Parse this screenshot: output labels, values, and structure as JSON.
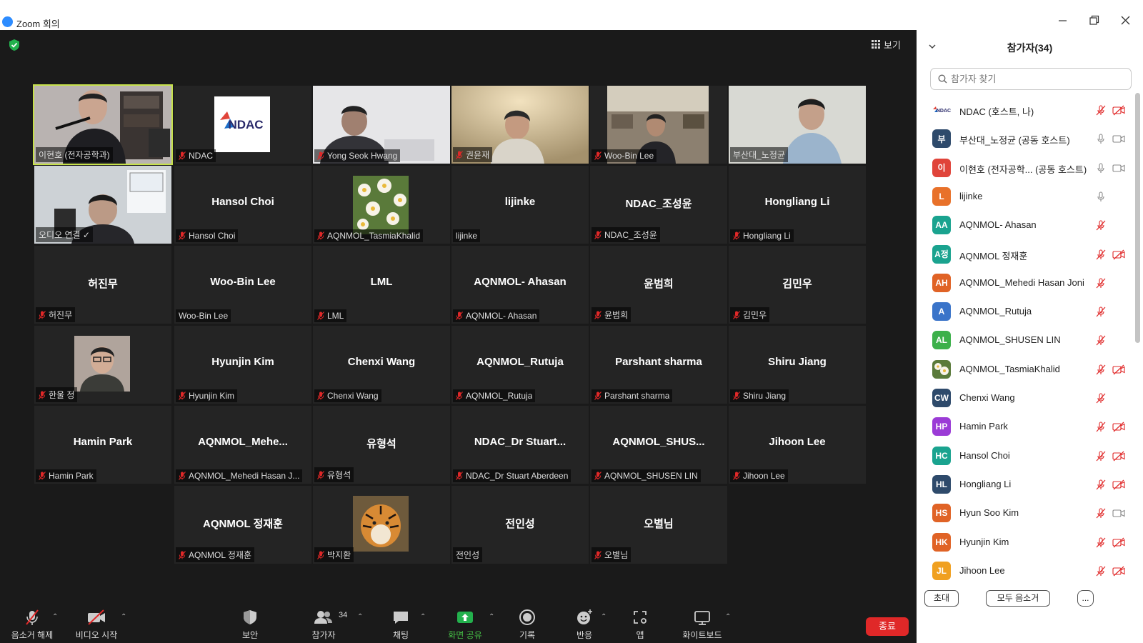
{
  "window": {
    "title": "Zoom 회의"
  },
  "meeting": {
    "view_label": "보기",
    "tiles": [
      {
        "row": 0,
        "col": 0,
        "name": "이현호 (전자공학과)",
        "center": "",
        "muted": false,
        "video": "cam1",
        "active": true
      },
      {
        "row": 0,
        "col": 1,
        "name": "NDAC",
        "center": "",
        "muted": true,
        "video": "ndac"
      },
      {
        "row": 0,
        "col": 2,
        "name": "Yong Seok Hwang",
        "center": "",
        "muted": true,
        "video": "cam2"
      },
      {
        "row": 0,
        "col": 3,
        "name": "권윤재",
        "center": "",
        "muted": true,
        "video": "cam3"
      },
      {
        "row": 0,
        "col": 4,
        "name": "Woo-Bin Lee",
        "center": "",
        "muted": true,
        "video": "cam4"
      },
      {
        "row": 0,
        "col": 5,
        "name": "부산대_노정균",
        "center": "",
        "muted": false,
        "video": "cam5"
      },
      {
        "row": 1,
        "col": 0,
        "name": "오디오 연결 ✓",
        "center": "",
        "muted": false,
        "video": "cam6"
      },
      {
        "row": 1,
        "col": 1,
        "name": "Hansol Choi",
        "center": "Hansol Choi",
        "muted": true
      },
      {
        "row": 1,
        "col": 2,
        "name": "AQNMOL_TasmiaKhalid",
        "center": "",
        "muted": true,
        "video": "flower"
      },
      {
        "row": 1,
        "col": 3,
        "name": "lijinke",
        "center": "lijinke",
        "muted": false
      },
      {
        "row": 1,
        "col": 4,
        "name": "NDAC_조성윤",
        "center": "NDAC_조성윤",
        "muted": true
      },
      {
        "row": 1,
        "col": 5,
        "name": "Hongliang Li",
        "center": "Hongliang Li",
        "muted": true
      },
      {
        "row": 2,
        "col": 0,
        "name": "허진무",
        "center": "허진무",
        "muted": true
      },
      {
        "row": 2,
        "col": 1,
        "name": "Woo-Bin Lee",
        "center": "Woo-Bin Lee",
        "muted": false
      },
      {
        "row": 2,
        "col": 2,
        "name": "LML",
        "center": "LML",
        "muted": true
      },
      {
        "row": 2,
        "col": 3,
        "name": "AQNMOL- Ahasan",
        "center": "AQNMOL- Ahasan",
        "muted": true
      },
      {
        "row": 2,
        "col": 4,
        "name": "윤범희",
        "center": "윤범희",
        "muted": true
      },
      {
        "row": 2,
        "col": 5,
        "name": "김민우",
        "center": "김민우",
        "muted": true
      },
      {
        "row": 3,
        "col": 0,
        "name": "한울 정",
        "center": "",
        "muted": true,
        "video": "portrait"
      },
      {
        "row": 3,
        "col": 1,
        "name": "Hyunjin Kim",
        "center": "Hyunjin Kim",
        "muted": true
      },
      {
        "row": 3,
        "col": 2,
        "name": "Chenxi Wang",
        "center": "Chenxi Wang",
        "muted": true
      },
      {
        "row": 3,
        "col": 3,
        "name": "AQNMOL_Rutuja",
        "center": "AQNMOL_Rutuja",
        "muted": true
      },
      {
        "row": 3,
        "col": 4,
        "name": "Parshant sharma",
        "center": "Parshant sharma",
        "muted": true
      },
      {
        "row": 3,
        "col": 5,
        "name": "Shiru Jiang",
        "center": "Shiru Jiang",
        "muted": true
      },
      {
        "row": 4,
        "col": 0,
        "name": "Hamin Park",
        "center": "Hamin Park",
        "muted": true
      },
      {
        "row": 4,
        "col": 1,
        "name": "AQNMOL_Mehedi Hasan J...",
        "center": "AQNMOL_Mehe...",
        "muted": true
      },
      {
        "row": 4,
        "col": 2,
        "name": "유형석",
        "center": "유형석",
        "muted": true
      },
      {
        "row": 4,
        "col": 3,
        "name": "NDAC_Dr Stuart Aberdeen",
        "center": "NDAC_Dr  Stuart...",
        "muted": true
      },
      {
        "row": 4,
        "col": 4,
        "name": "AQNMOL_SHUSEN LIN",
        "center": "AQNMOL_SHUS...",
        "muted": true
      },
      {
        "row": 4,
        "col": 5,
        "name": "Jihoon Lee",
        "center": "Jihoon Lee",
        "muted": true
      },
      {
        "row": 5,
        "col": 1,
        "name": "AQNMOL 정재훈",
        "center": "AQNMOL 정재훈",
        "muted": true
      },
      {
        "row": 5,
        "col": 2,
        "name": "박지환",
        "center": "",
        "muted": true,
        "video": "tiger"
      },
      {
        "row": 5,
        "col": 3,
        "name": "전인성",
        "center": "전인성",
        "muted": false
      },
      {
        "row": 5,
        "col": 4,
        "name": "오별님",
        "center": "오별님",
        "muted": true
      }
    ],
    "ndac_logo_text": "NDAC"
  },
  "toolbar": {
    "unmute": "음소거 해제",
    "start_video": "비디오 시작",
    "security": "보안",
    "participants": "참가자",
    "participants_count": "34",
    "chat": "채팅",
    "share": "화면 공유",
    "record": "기록",
    "reactions": "반응",
    "apps": "앱",
    "whiteboard": "화이트보드",
    "end": "종료"
  },
  "panel": {
    "title": "참가자(34)",
    "search_placeholder": "참가자 찾기",
    "participants": [
      {
        "initials": "NDAC",
        "name": "NDAC (호스트, 나)",
        "color": "#ffffff",
        "mic": "off",
        "cam": "off",
        "logo": true
      },
      {
        "initials": "부",
        "name": "부산대_노정균 (공동 호스트)",
        "color": "#2e4a6b",
        "mic": "on",
        "cam": "on"
      },
      {
        "initials": "이",
        "name": "이현호 (전자공학... (공동 호스트)",
        "color": "#e0443a",
        "mic": "on",
        "cam": "on"
      },
      {
        "initials": "L",
        "name": "lijinke",
        "color": "#e8712a",
        "mic": "on",
        "cam": "none"
      },
      {
        "initials": "AA",
        "name": "AQNMOL- Ahasan",
        "color": "#1aa38f",
        "mic": "off",
        "cam": "none"
      },
      {
        "initials": "A정",
        "name": "AQNMOL 정재훈",
        "color": "#1aa38f",
        "mic": "off",
        "cam": "off"
      },
      {
        "initials": "AH",
        "name": "AQNMOL_Mehedi Hasan Joni",
        "color": "#e06326",
        "mic": "off",
        "cam": "none"
      },
      {
        "initials": "A",
        "name": "AQNMOL_Rutuja",
        "color": "#3a74c9",
        "mic": "off",
        "cam": "none"
      },
      {
        "initials": "AL",
        "name": "AQNMOL_SHUSEN LIN",
        "color": "#3cb04a",
        "mic": "off",
        "cam": "none"
      },
      {
        "initials": "",
        "name": "AQNMOL_TasmiaKhalid",
        "color": "#8a7a40",
        "mic": "off",
        "cam": "off",
        "photo": true
      },
      {
        "initials": "CW",
        "name": "Chenxi Wang",
        "color": "#2e4a6b",
        "mic": "off",
        "cam": "none"
      },
      {
        "initials": "HP",
        "name": "Hamin Park",
        "color": "#9b3bd6",
        "mic": "off",
        "cam": "off"
      },
      {
        "initials": "HC",
        "name": "Hansol Choi",
        "color": "#1aa38f",
        "mic": "off",
        "cam": "off"
      },
      {
        "initials": "HL",
        "name": "Hongliang Li",
        "color": "#2e4a6b",
        "mic": "off",
        "cam": "off"
      },
      {
        "initials": "HS",
        "name": "Hyun Soo Kim",
        "color": "#e06326",
        "mic": "off",
        "cam": "on"
      },
      {
        "initials": "HK",
        "name": "Hyunjin Kim",
        "color": "#e06326",
        "mic": "off",
        "cam": "off"
      },
      {
        "initials": "JL",
        "name": "Jihoon Lee",
        "color": "#f0a020",
        "mic": "off",
        "cam": "off"
      }
    ],
    "invite": "초대",
    "mute_all": "모두 음소거",
    "more": "..."
  }
}
